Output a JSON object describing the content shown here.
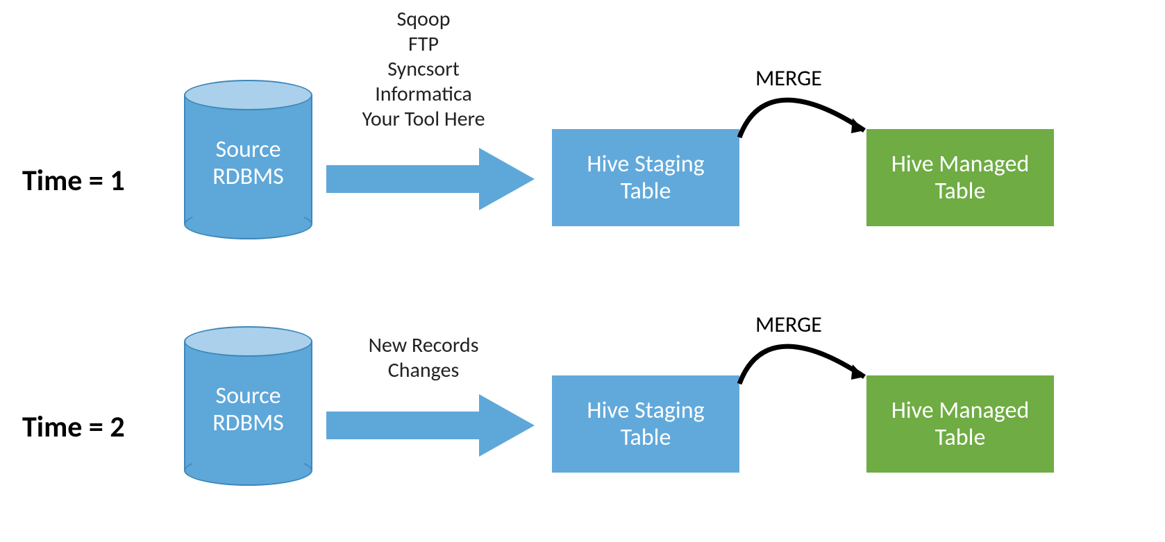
{
  "row1": {
    "timeLabel": "Time = 1",
    "sourceLine1": "Source",
    "sourceLine2": "RDBMS",
    "tools1": "Sqoop",
    "tools2": "FTP",
    "tools3": "Syncsort",
    "tools4": "Informatica",
    "tools5": "Your Tool Here",
    "stagingLine1": "Hive Staging",
    "stagingLine2": "Table",
    "mergeLabel": "MERGE",
    "managedLine1": "Hive Managed",
    "managedLine2": "Table"
  },
  "row2": {
    "timeLabel": "Time = 2",
    "sourceLine1": "Source",
    "sourceLine2": "RDBMS",
    "tools1": "New Records",
    "tools2": "Changes",
    "stagingLine1": "Hive Staging",
    "stagingLine2": "Table",
    "mergeLabel": "MERGE",
    "managedLine1": "Hive Managed",
    "managedLine2": "Table"
  },
  "colors": {
    "cylinderBody": "#5ea7d9",
    "cylinderTop": "#aad0eb",
    "arrowBlue": "#5ea7d9",
    "stagingBlue": "#62a9db",
    "managedGreen": "#6fac44"
  }
}
